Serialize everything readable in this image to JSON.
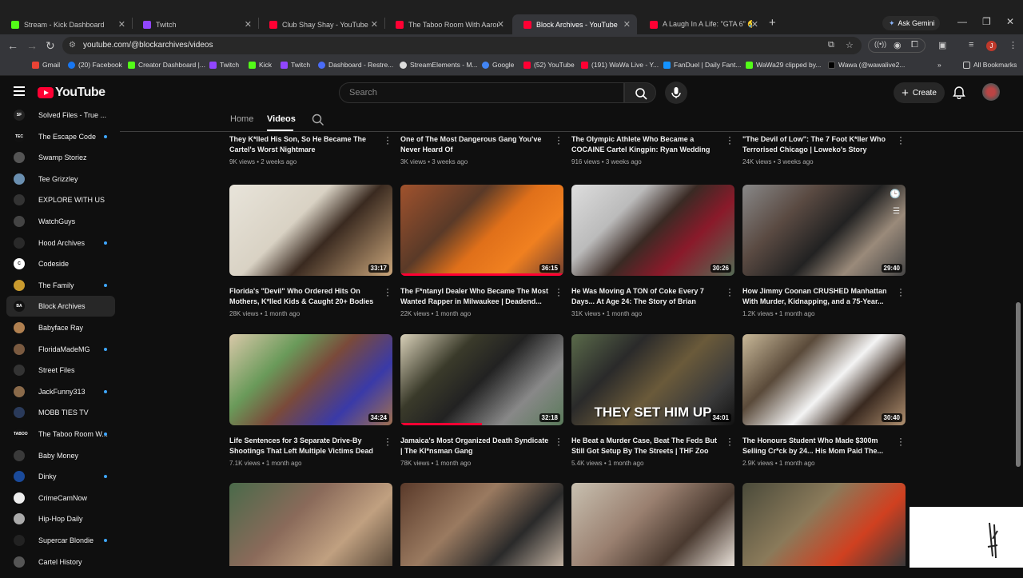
{
  "browser": {
    "tabs": [
      {
        "label": "Stream - Kick Dashboard",
        "color": "#53fc18"
      },
      {
        "label": "Twitch",
        "color": "#9146ff"
      },
      {
        "label": "Club Shay Shay - YouTube",
        "color": "#ff0033"
      },
      {
        "label": "The Taboo Room With Aaron S",
        "color": "#ff0033"
      },
      {
        "label": "Block Archives - YouTube",
        "color": "#ff0033"
      },
      {
        "label": "A Laugh In A Life: \"GTA 6\" 🤣",
        "color": "#ff0033"
      }
    ],
    "ask_gemini": "Ask Gemini",
    "url": "youtube.com/@blockarchives/videos",
    "profile_initial": "J",
    "bookmarks": [
      {
        "label": "Gmail",
        "color": "#ea4335"
      },
      {
        "label": "(20) Facebook",
        "color": "#1877f2"
      },
      {
        "label": "Creator Dashboard |...",
        "color": "#53fc18"
      },
      {
        "label": "Twitch",
        "color": "#9146ff"
      },
      {
        "label": "Kick",
        "color": "#53fc18"
      },
      {
        "label": "Twitch",
        "color": "#9146ff"
      },
      {
        "label": "Dashboard - Restre...",
        "color": "#4a6cf7"
      },
      {
        "label": "StreamElements - M...",
        "color": "#dddddd"
      },
      {
        "label": "Google",
        "color": "#4285f4"
      },
      {
        "label": "(52) YouTube",
        "color": "#ff0033"
      },
      {
        "label": "(191) WaWa Live - Y...",
        "color": "#ff0033"
      },
      {
        "label": "FanDuel | Daily Fant...",
        "color": "#1493ff"
      },
      {
        "label": "WaWa29 clipped by...",
        "color": "#53fc18"
      },
      {
        "label": "Wawa (@wawalive2...",
        "color": "#000000"
      }
    ],
    "all_bookmarks": "All Bookmarks"
  },
  "header": {
    "logo_text": "YouTube",
    "search_placeholder": "Search",
    "create_label": "Create"
  },
  "sidebar": {
    "items": [
      {
        "label": "Solved Files - True ...",
        "badge": "SF",
        "color": "#222",
        "dot": false
      },
      {
        "label": "The Escape Code",
        "badge": "TEC",
        "color": "#111",
        "dot": true
      },
      {
        "label": "Swamp Storiez",
        "badge": "",
        "color": "#555",
        "dot": false
      },
      {
        "label": "Tee Grizzley",
        "badge": "",
        "color": "#6a8fb0",
        "dot": false
      },
      {
        "label": "EXPLORE WITH US",
        "badge": "",
        "color": "#333",
        "dot": false
      },
      {
        "label": "WatchGuys",
        "badge": "",
        "color": "#444",
        "dot": false
      },
      {
        "label": "Hood Archives",
        "badge": "",
        "color": "#2a2a2a",
        "dot": true
      },
      {
        "label": "Codeside",
        "badge": "C",
        "color": "#fff",
        "dot": false
      },
      {
        "label": "The Family",
        "badge": "",
        "color": "#c99a2e",
        "dot": true
      },
      {
        "label": "Block Archives",
        "badge": "BA",
        "color": "#111",
        "dot": false
      },
      {
        "label": "Babyface Ray",
        "badge": "",
        "color": "#b08050",
        "dot": false
      },
      {
        "label": "FloridaMadeMG",
        "badge": "",
        "color": "#7a5a40",
        "dot": true
      },
      {
        "label": "Street Files",
        "badge": "",
        "color": "#333",
        "dot": false
      },
      {
        "label": "JackFunny313",
        "badge": "",
        "color": "#8a6a4a",
        "dot": true
      },
      {
        "label": "MOBB TIES TV",
        "badge": "",
        "color": "#2a3a5a",
        "dot": false
      },
      {
        "label": "The Taboo Room W...",
        "badge": "TABOO",
        "color": "#111",
        "dot": true
      },
      {
        "label": "Baby Money",
        "badge": "",
        "color": "#3a3a3a",
        "dot": false
      },
      {
        "label": "Dinky",
        "badge": "",
        "color": "#1a4a9a",
        "dot": true
      },
      {
        "label": "CrimeCamNow",
        "badge": "",
        "color": "#eee",
        "dot": false
      },
      {
        "label": "Hip-Hop Daily",
        "badge": "",
        "color": "#aaa",
        "dot": false
      },
      {
        "label": "Supercar Blondie",
        "badge": "",
        "color": "#222",
        "dot": true
      },
      {
        "label": "Cartel History",
        "badge": "",
        "color": "#555",
        "dot": false
      }
    ]
  },
  "channel_tabs": {
    "home": "Home",
    "videos": "Videos"
  },
  "videos_top_row": [
    {
      "title": "They K*lled His Son, So He Became The Cartel's Worst Nightmare",
      "meta": "9K views • 2 weeks ago"
    },
    {
      "title": "One of The Most Dangerous Gang You've Never Heard Of",
      "meta": "3K views • 3 weeks ago"
    },
    {
      "title": "The Olympic Athlete Who Became a COCAINE Cartel Kingpin: Ryan Wedding",
      "meta": "916 views • 3 weeks ago"
    },
    {
      "title": "\"The Devil of Low\": The 7 Foot K*ller Who Terrorised Chicago | Loweko's Story",
      "meta": "24K views • 3 weeks ago"
    }
  ],
  "videos_row2": [
    {
      "title": "Florida's \"Devil\" Who Ordered Hits On Mothers, K*lled Kids & Caught 20+ Bodies |...",
      "meta": "28K views • 1 month ago",
      "duration": "33:17",
      "progress": 0,
      "bg": "linear-gradient(135deg,#e8e4da 0%,#d9d2c4 40%,#3a2a20 60%,#c9a57a 100%)"
    },
    {
      "title": "The F*ntanyl Dealer Who Became The Most Wanted Rapper in Milwaukee | Deadend...",
      "meta": "22K views • 1 month ago",
      "duration": "36:15",
      "progress": 1.0,
      "bg": "linear-gradient(135deg,#a0522d 0%,#5a3a28 35%,#e0701a 55%,#f08020 75%,#704030 100%)"
    },
    {
      "title": "He Was Moving A TON of Coke Every 7 Days... At Age 24: The Story of Brian Bennett",
      "meta": "31K views • 1 month ago",
      "duration": "30:26",
      "progress": 0,
      "bg": "linear-gradient(135deg,#ddd 0%,#bbb 30%,#3a2a24 50%,#8a1a2a 70%,#556b55 100%)"
    },
    {
      "title": "How Jimmy Coonan CRUSHED Manhattan With Murder, Kidnapping, and a 75-Year...",
      "meta": "1.2K views • 1 month ago",
      "duration": "29:40",
      "progress": 0,
      "bg": "linear-gradient(135deg,#888 0%,#5a4a42 30%,#222 55%,#9a8a7a 75%,#444 100%)"
    }
  ],
  "videos_row3": [
    {
      "title": "Life Sentences for 3 Separate Drive-By Shootings That Left Multiple Victims Dead i...",
      "meta": "7.1K views • 1 month ago",
      "duration": "34:24",
      "progress": 0,
      "bg": "linear-gradient(135deg,#d8c8a8 0%,#6a9a5a 30%,#7a4a3a 50%,#3a3aa8 75%,#a07050 100%)"
    },
    {
      "title": "Jamaica's Most Organized Death Syndicate | The Kl*nsman Gang",
      "meta": "78K views • 1 month ago",
      "duration": "32:18",
      "progress": 0.5,
      "bg": "linear-gradient(135deg,#d8d0b8 0%,#3a3a2a 30%,#222 50%,#888 75%,#5a7a5a 100%)"
    },
    {
      "title": "He Beat a Murder Case, Beat The Feds But Still Got Setup By The Streets | THF Zoo",
      "meta": "5.4K views • 1 month ago",
      "duration": "34:01",
      "progress": 0,
      "bg": "linear-gradient(135deg,#5a6a4a 0%,#2a2a2a 30%,#6a5a3a 55%,#3a3a3a 80%,#111 100%)",
      "overlay": "THEY SET HIM UP"
    },
    {
      "title": "The Honours Student Who Made $300m Selling Cr*ck by 24... His Mom Paid The...",
      "meta": "2.9K views • 1 month ago",
      "duration": "30:40",
      "progress": 0,
      "bg": "linear-gradient(135deg,#c8b898 0%,#5a4a3a 30%,#f4f4f4 55%,#3a2a20 75%,#b09070 100%)"
    }
  ],
  "videos_row4": [
    {
      "bg": "linear-gradient(135deg,#4a6a4a 0%,#8a6a5a 40%,#c0a080 70%,#5a4a3a 100%)"
    },
    {
      "bg": "linear-gradient(135deg,#5a3a2a 0%,#9a7a60 40%,#2a2a2a 70%,#c0b0a0 100%)"
    },
    {
      "bg": "linear-gradient(135deg,#c8c0b0 0%,#9a8070 40%,#4a3a30 70%,#e8e0d8 100%)"
    },
    {
      "bg": "linear-gradient(135deg,#4a4a3a 0%,#8a7a5a 40%,#d04020 70%,#3a3a3a 100%)"
    }
  ]
}
